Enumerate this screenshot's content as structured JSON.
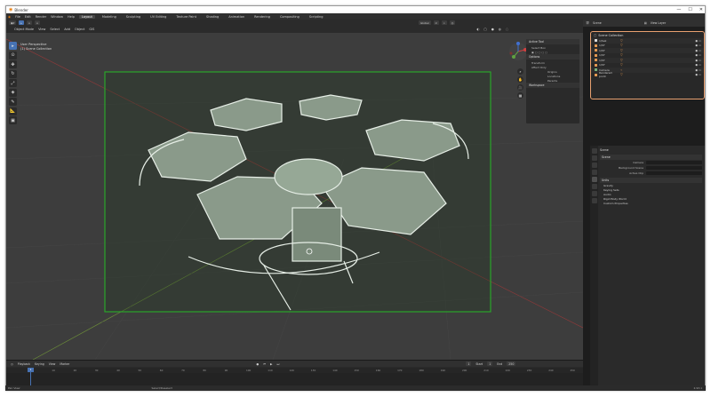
{
  "window": {
    "title": "Blender"
  },
  "menu": [
    "File",
    "Edit",
    "Render",
    "Window",
    "Help"
  ],
  "workspaces": [
    {
      "label": "Layout",
      "active": true
    },
    {
      "label": "Modeling"
    },
    {
      "label": "Sculpting"
    },
    {
      "label": "UV Editing"
    },
    {
      "label": "Texture Paint"
    },
    {
      "label": "Shading"
    },
    {
      "label": "Animation"
    },
    {
      "label": "Rendering"
    },
    {
      "label": "Compositing"
    },
    {
      "label": "Scripting"
    }
  ],
  "scene_selector": "Scene",
  "view_layer": "View Layer",
  "viewport": {
    "header": [
      "Object Mode",
      "View",
      "Select",
      "Add",
      "Object",
      "GIS"
    ],
    "transform": "Global",
    "info_line1": "User Perspective",
    "info_line2": "(1) Scene Collection"
  },
  "npanel": {
    "active_tool": "Active Tool",
    "select_box": "Select Box",
    "options": "Options",
    "transform": "Transform",
    "affect_only": "Affect Only",
    "origins": "Origins",
    "locations": "Locations",
    "parents": "Parents",
    "workspace": "Workspace"
  },
  "outliner": {
    "header": "Scene Collection",
    "items": [
      {
        "label": "1/Sek",
        "type": "col"
      },
      {
        "label": "1/ST",
        "type": "obj"
      },
      {
        "label": "1/ST",
        "type": "obj"
      },
      {
        "label": "1/ST",
        "type": "obj"
      },
      {
        "label": "1/ST",
        "type": "obj"
      },
      {
        "label": "1/ST",
        "type": "obj"
      },
      {
        "label": "Camera",
        "type": "cam"
      },
      {
        "label": "Rendered: point",
        "type": "obj"
      }
    ]
  },
  "properties": {
    "title": "Scene",
    "section_scene": "Scene",
    "camera_label": "Camera",
    "background_label": "Background Scene",
    "active_clip_label": "Active Clip",
    "units": "Units",
    "gravity": "Gravity",
    "keying_sets": "Keying Sets",
    "audio": "Audio",
    "rigid_body": "Rigid Body World",
    "custom_props": "Custom Properties"
  },
  "timeline": {
    "header": [
      "Playback",
      "Keying",
      "View",
      "Marker"
    ],
    "start_label": "Start",
    "start": "1",
    "end_label": "End",
    "end": "250",
    "current_frame": "1",
    "ticks": [
      "0",
      "10",
      "20",
      "30",
      "40",
      "50",
      "60",
      "70",
      "80",
      "90",
      "100",
      "110",
      "120",
      "130",
      "140",
      "150",
      "160",
      "170",
      "180",
      "190",
      "200",
      "210",
      "220",
      "230",
      "240",
      "250"
    ]
  },
  "status": {
    "left": "Pan View",
    "middle": "Select/Deselect",
    "version": "2.93.1"
  },
  "colors": {
    "viewport_bg": "#3d3d3d",
    "camera_frame": "#2aa52a",
    "outliner_highlight": "#e8a070",
    "active_blue": "#4772b3"
  }
}
